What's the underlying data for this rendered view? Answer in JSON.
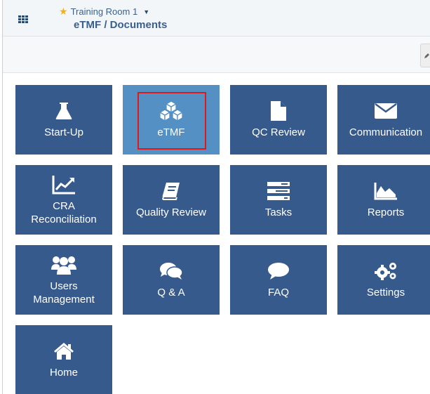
{
  "header": {
    "room_name": "Training Room 1",
    "breadcrumb": "eTMF / Documents"
  },
  "colors": {
    "tile": "#375a8c",
    "tile_active": "#5590c4",
    "highlight": "#e01818",
    "star": "#f2b01e"
  },
  "tiles": [
    {
      "label": "Start-Up",
      "icon": "flask-icon"
    },
    {
      "label": "eTMF",
      "icon": "cubes-icon",
      "active": true
    },
    {
      "label": "QC Review",
      "icon": "file-icon"
    },
    {
      "label": "Communication",
      "icon": "envelope-icon"
    },
    {
      "label": "CRA Reconciliation",
      "icon": "line-chart-icon"
    },
    {
      "label": "Quality Review",
      "icon": "book-icon"
    },
    {
      "label": "Tasks",
      "icon": "tasks-icon"
    },
    {
      "label": "Reports",
      "icon": "area-chart-icon"
    },
    {
      "label": "Users Management",
      "icon": "users-icon"
    },
    {
      "label": "Q & A",
      "icon": "comments-icon"
    },
    {
      "label": "FAQ",
      "icon": "comment-icon"
    },
    {
      "label": "Settings",
      "icon": "cogs-icon"
    },
    {
      "label": "Home",
      "icon": "home-icon"
    }
  ]
}
